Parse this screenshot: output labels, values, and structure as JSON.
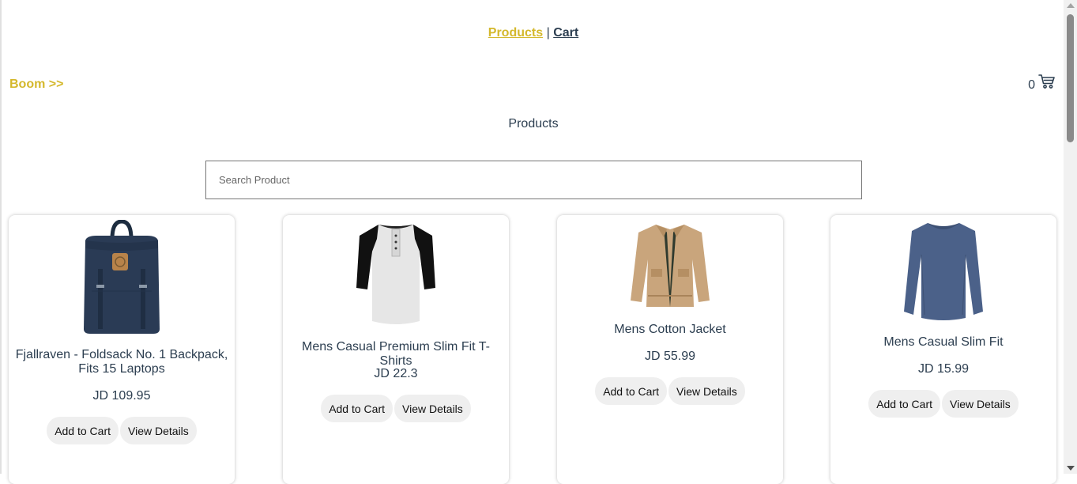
{
  "nav": {
    "products": "Products",
    "separator": "|",
    "cart": "Cart"
  },
  "brand": "Boom >>",
  "cart_widget": {
    "count": "0",
    "icon": "cart-icon"
  },
  "section_title": "Products",
  "search": {
    "placeholder": "Search Product",
    "value": ""
  },
  "products": [
    {
      "name": "Fjallraven - Foldsack No. 1 Backpack, Fits 15 Laptops",
      "price": "JD 109.95",
      "add_label": "Add to Cart",
      "details_label": "View Details"
    },
    {
      "name": "Mens Casual Premium Slim Fit T-Shirts",
      "price": "JD 22.3",
      "add_label": "Add to Cart",
      "details_label": "View Details"
    },
    {
      "name": "Mens Cotton Jacket",
      "price": "JD 55.99",
      "add_label": "Add to Cart",
      "details_label": "View Details"
    },
    {
      "name": "Mens Casual Slim Fit",
      "price": "JD 15.99",
      "add_label": "Add to Cart",
      "details_label": "View Details"
    }
  ],
  "colors": {
    "accent": "#d4b82c",
    "text": "#2c3e50",
    "button_bg": "#efefef"
  }
}
